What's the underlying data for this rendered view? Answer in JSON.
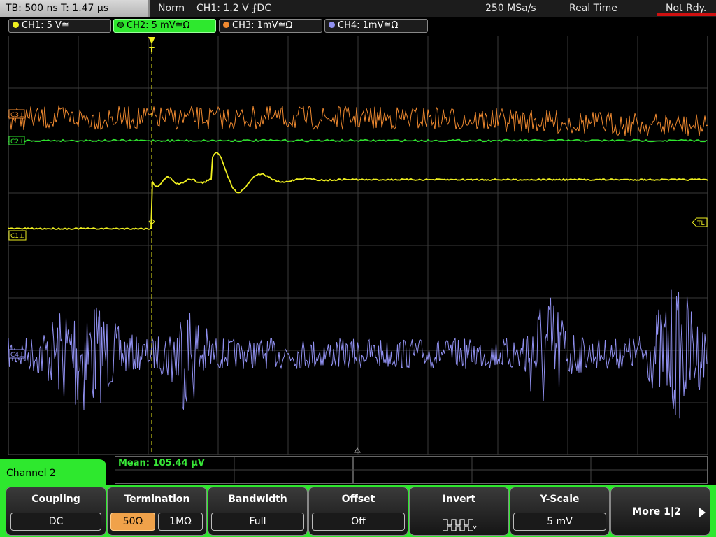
{
  "status_bar": {
    "timebase": "TB: 500 ns   T: 1.47 µs",
    "trigger_mode": "Norm",
    "trigger_info": "CH1: 1.2 V ⨍DC",
    "sample_rate": "250 MSa/s",
    "acquisition_mode": "Real Time",
    "trigger_status": "Not Rdy.",
    "trigger_status_color": "#d01010"
  },
  "channel_tabs": [
    {
      "label": "CH1: 5 V≅",
      "color": "#f0f020"
    },
    {
      "label": "CH2: 5 mV≅Ω",
      "color": "#2ee82e"
    },
    {
      "label": "CH3: 1mV≅Ω",
      "color": "#f08a30"
    },
    {
      "label": "CH4: 1mV≅Ω",
      "color": "#9090f0"
    }
  ],
  "graticule": {
    "markers": {
      "ch3": "C3⊥",
      "ch2": "C2⊥",
      "ch1": "C1⊥",
      "ch4": "C4⊥",
      "trigger_level": "TL",
      "trigger_position": "T"
    },
    "colors": {
      "ch1": "#f0f020",
      "ch2": "#2ee82e",
      "ch3": "#f08a30",
      "ch4": "#9090f0",
      "grid": "#3a3a3a"
    }
  },
  "measurement": {
    "mean": "Mean: 105.44 µV"
  },
  "channel_label": "Channel 2",
  "softkeys": {
    "coupling": {
      "title": "Coupling",
      "value": "DC"
    },
    "termination": {
      "title": "Termination",
      "option_50": "50Ω",
      "option_1m": "1MΩ",
      "selected": "50Ω"
    },
    "bandwidth": {
      "title": "Bandwidth",
      "value": "Full"
    },
    "offset": {
      "title": "Offset",
      "value": "Off"
    },
    "invert": {
      "title": "Invert",
      "icon": "square-wave-icon"
    },
    "y_scale": {
      "title": "Y-Scale",
      "value": "5 mV"
    },
    "more": {
      "label": "More 1|2",
      "icon": "arrow-right-icon"
    }
  }
}
